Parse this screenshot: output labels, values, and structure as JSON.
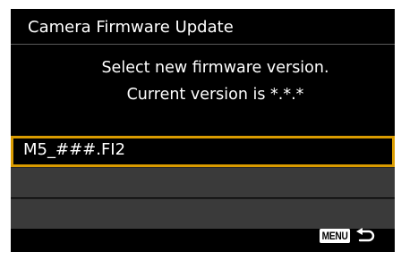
{
  "title": "Camera Firmware Update",
  "message": {
    "line1": "Select new firmware version.",
    "line2": "Current version is *.*.*"
  },
  "files": [
    {
      "name": "M5_###.FI2",
      "selected": true
    },
    {
      "name": "",
      "selected": false
    },
    {
      "name": "",
      "selected": false
    }
  ],
  "footer": {
    "menu_label": "MENU",
    "back_icon": "return-arrow-icon"
  },
  "colors": {
    "background": "#000000",
    "selection_border": "#d99b00",
    "row_fill": "#3a3a3a",
    "text": "#ffffff"
  }
}
